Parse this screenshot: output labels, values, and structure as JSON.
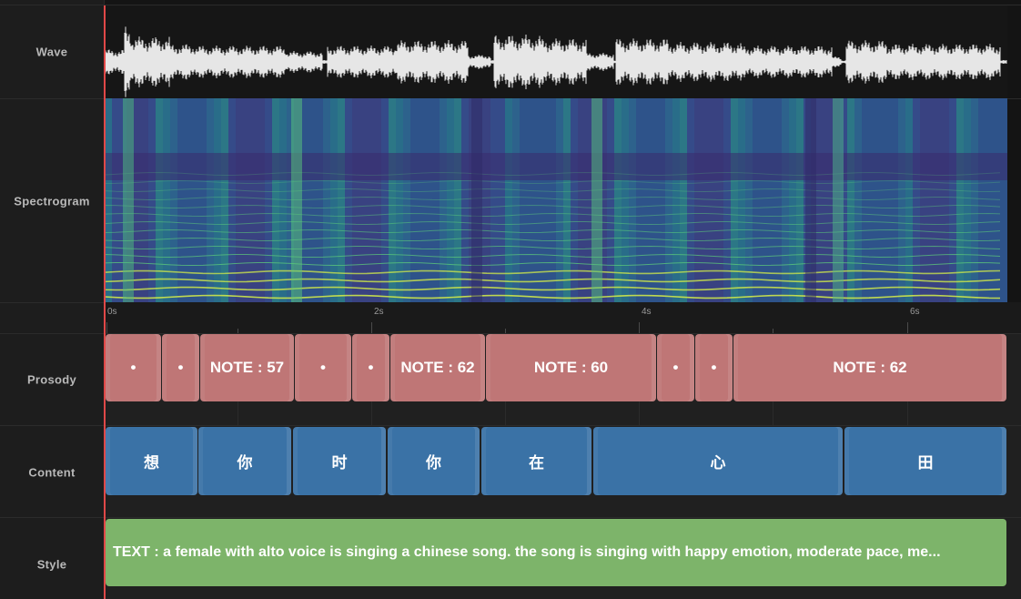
{
  "tracks": {
    "wave": "Wave",
    "spectrogram": "Spectrogram",
    "prosody": "Prosody",
    "content": "Content",
    "style": "Style"
  },
  "ruler": {
    "labels": [
      "0s",
      "2s",
      "4s",
      "6s"
    ]
  },
  "prosody_blocks": [
    {
      "label": "•"
    },
    {
      "label": "•"
    },
    {
      "label": "NOTE : 57"
    },
    {
      "label": "•"
    },
    {
      "label": "•"
    },
    {
      "label": "NOTE : 62"
    },
    {
      "label": "NOTE : 60"
    },
    {
      "label": "•"
    },
    {
      "label": "•"
    },
    {
      "label": "NOTE : 62"
    }
  ],
  "content_blocks": [
    {
      "label": "想"
    },
    {
      "label": "你"
    },
    {
      "label": "时"
    },
    {
      "label": "你"
    },
    {
      "label": "在"
    },
    {
      "label": "心"
    },
    {
      "label": "田"
    }
  ],
  "style_block": {
    "label": "TEXT : a female with alto voice is singing a chinese song. the song is singing with happy emotion, moderate pace, me..."
  },
  "colors": {
    "prosody": "#bf7676",
    "content": "#3a72a6",
    "style": "#7db46a",
    "playhead": "#e04848"
  }
}
